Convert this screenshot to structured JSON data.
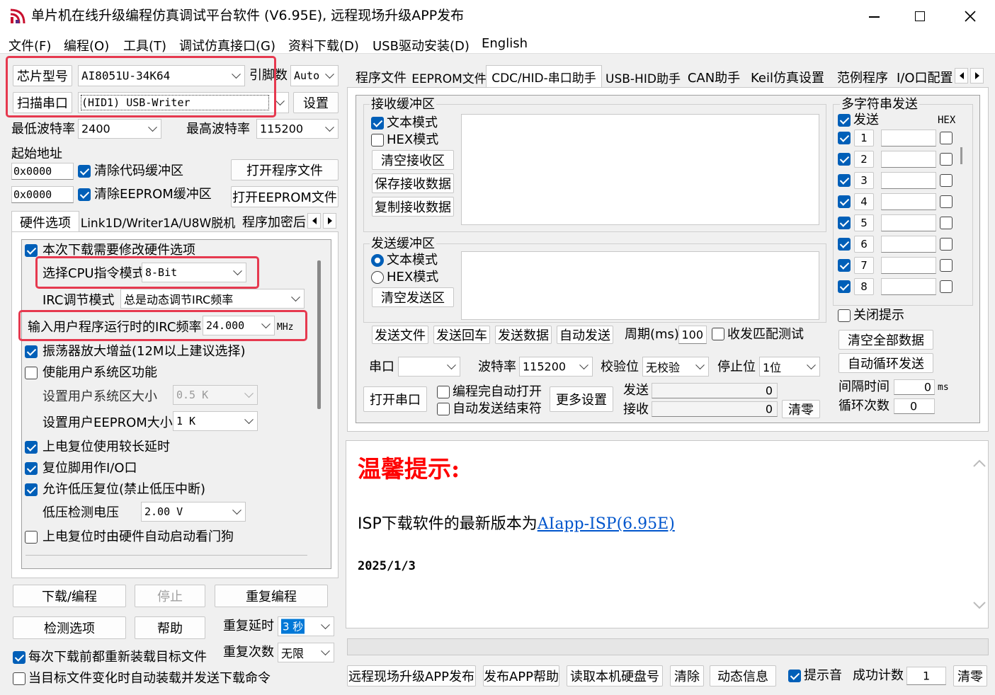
{
  "window": {
    "title": "单片机在线升级编程仿真调试平台软件 (V6.95E), 远程现场升级APP发布"
  },
  "menu": [
    "文件(F)",
    "编程(O)",
    "工具(T)",
    "调试仿真接口(G)",
    "资料下载(D)",
    "USB驱动安装(D)",
    "English"
  ],
  "left": {
    "chip_label": "芯片型号",
    "chip_value": "AI8051U-34K64",
    "pins_label": "引脚数",
    "pins_value": "Auto",
    "scan_label": "扫描串口",
    "port_value": "(HID1) USB-Writer",
    "settings_label": "设置",
    "min_baud_label": "最低波特率",
    "min_baud_value": "2400",
    "max_baud_label": "最高波特率",
    "max_baud_value": "115200",
    "start_addr_label": "起始地址",
    "code_addr": "0x0000",
    "eeprom_addr": "0x0000",
    "clear_code_label": "清除代码缓冲区",
    "clear_eeprom_label": "清除EEPROM缓冲区",
    "open_program_label": "打开程序文件",
    "open_eeprom_label": "打开EEPROM文件",
    "tabs": [
      "硬件选项",
      "Link1D/Writer1A/U8W脱机",
      "程序加密后"
    ],
    "hw": {
      "modify_label": "本次下载需要修改硬件选项",
      "cpu_mode_label": "选择CPU指令模式",
      "cpu_mode_value": "8-Bit",
      "irc_mode_label": "IRC调节模式",
      "irc_mode_value": "总是动态调节IRC频率",
      "irc_freq_label": "输入用户程序运行时的IRC频率",
      "irc_freq_value": "24.000",
      "irc_freq_unit": "MHz",
      "osc_gain_label": "振荡器放大增益(12M以上建议选择)",
      "user_sys_label": "使能用户系统区功能",
      "sys_size_label": "设置用户系统区大小",
      "sys_size_value": "0.5  K",
      "eeprom_size_label": "设置用户EEPROM大小",
      "eeprom_size_value": "1    K",
      "long_delay_label": "上电复位使用较长延时",
      "reset_io_label": "复位脚用作I/O口",
      "lvr_label": "允许低压复位(禁止低压中断)",
      "lvd_label": "低压检测电压",
      "lvd_value": "2.00 V",
      "wdt_label": "上电复位时由硬件自动启动看门狗"
    },
    "download_label": "下载/编程",
    "stop_label": "停止",
    "reprogram_label": "重复编程",
    "detect_label": "检测选项",
    "help_label": "帮助",
    "repeat_delay_label": "重复延时",
    "repeat_delay_value": "3 秒",
    "repeat_count_label": "重复次数",
    "repeat_count_value": "无限",
    "reload_label": "每次下载前都重新装载目标文件",
    "auto_reload_label": "当目标文件变化时自动装载并发送下载命令"
  },
  "right": {
    "tabs": [
      "程序文件",
      "EEPROM文件",
      "CDC/HID-串口助手",
      "USB-HID助手",
      "CAN助手",
      "Keil仿真设置",
      "范例程序",
      "I/O口配置"
    ],
    "recv": {
      "title": "接收缓冲区",
      "text_mode": "文本模式",
      "hex_mode": "HEX模式",
      "clear": "清空接收区",
      "save": "保存接收数据",
      "copy": "复制接收数据"
    },
    "send": {
      "title": "发送缓冲区",
      "text_mode": "文本模式",
      "hex_mode": "HEX模式",
      "clear": "清空发送区"
    },
    "send_file": "发送文件",
    "send_return": "发送回车",
    "send_data": "发送数据",
    "auto_send": "自动发送",
    "period_label": "周期(ms)",
    "period_value": "100",
    "match_label": "收发匹配测试",
    "port_label": "串口",
    "baud_label": "波特率",
    "baud_value": "115200",
    "parity_label": "校验位",
    "parity_value": "无校验",
    "stop_label": "停止位",
    "stop_value": "1位",
    "open_port": "打开串口",
    "auto_open": "编程完自动打开",
    "auto_end": "自动发送结束符",
    "more_settings": "更多设置",
    "send_count_label": "发送",
    "send_count": "0",
    "recv_count_label": "接收",
    "recv_count": "0",
    "clear_counts": "清零",
    "multi": {
      "title": "多字符串发送",
      "send_label": "发送",
      "hex_label": "HEX",
      "rows": [
        "1",
        "2",
        "3",
        "4",
        "5",
        "6",
        "7",
        "8"
      ],
      "close_tip": "关闭提示",
      "clear_all": "清空全部数据",
      "auto_loop": "自动循环发送",
      "interval_label": "间隔时间",
      "interval_value": "0",
      "interval_unit": "ms",
      "loop_label": "循环次数",
      "loop_value": "0"
    }
  },
  "notice": {
    "heading": "温馨提示:",
    "text": "ISP下载软件的最新版本为",
    "link": "AIapp-ISP(6.95E)",
    "date": "2025/1/3"
  },
  "bottom": {
    "remote": "远程现场升级APP发布",
    "app_help": "发布APP帮助",
    "read_disk": "读取本机硬盘号",
    "clear": "清除",
    "dynamic": "动态信息",
    "beep": "提示音",
    "success_label": "成功计数",
    "success_value": "1",
    "reset": "清零"
  },
  "colors": {
    "highlight": "#e6394f",
    "accent": "#005fb8",
    "notice": "#ff0000",
    "link": "#0055cc"
  }
}
